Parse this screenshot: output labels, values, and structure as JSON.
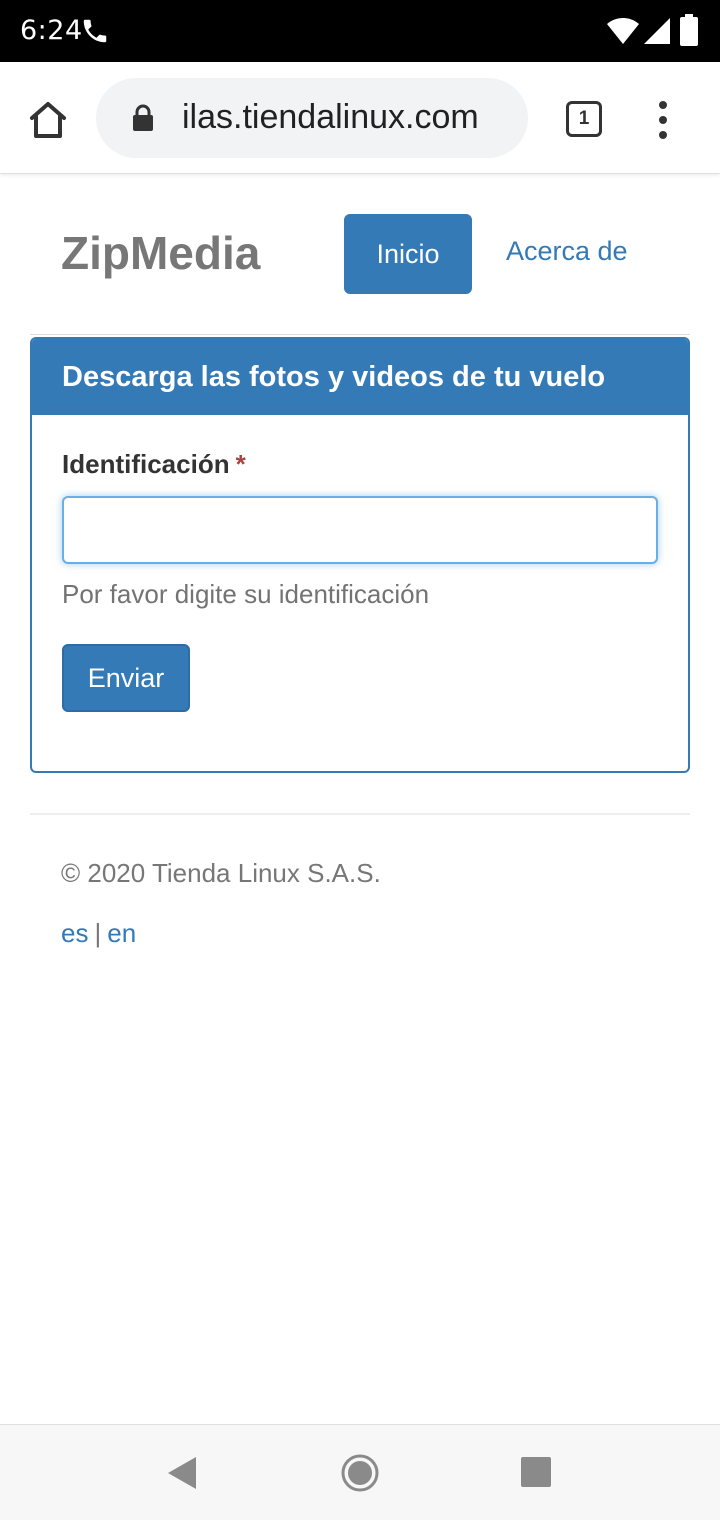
{
  "status_bar": {
    "time": "6:24",
    "icons": [
      "phone-icon",
      "wifi-icon",
      "signal-icon",
      "battery-icon"
    ]
  },
  "browser": {
    "url": "ilas.tiendalinux.com",
    "tab_count": "1",
    "icons": [
      "home-icon",
      "lock-icon",
      "tabs-icon",
      "more-vert-icon"
    ]
  },
  "header": {
    "brand": "ZipMedia",
    "nav": {
      "home": "Inicio",
      "about": "Acerca de"
    }
  },
  "panel": {
    "title": "Descarga las fotos y videos de tu vuelo",
    "field": {
      "label": "Identificación",
      "required_mark": "*",
      "value": "",
      "help": "Por favor digite su identificación"
    },
    "submit_label": "Enviar"
  },
  "footer": {
    "copyright": "© 2020 Tienda Linux S.A.S.",
    "languages": [
      "es",
      "en"
    ],
    "separator": "|"
  },
  "colors": {
    "primary": "#337ab7",
    "brand_text": "#777777",
    "required": "#a94442",
    "input_focus": "#66afe9"
  },
  "nav_bar": {
    "icons": [
      "back-icon",
      "home-circle-icon",
      "recents-icon"
    ]
  }
}
